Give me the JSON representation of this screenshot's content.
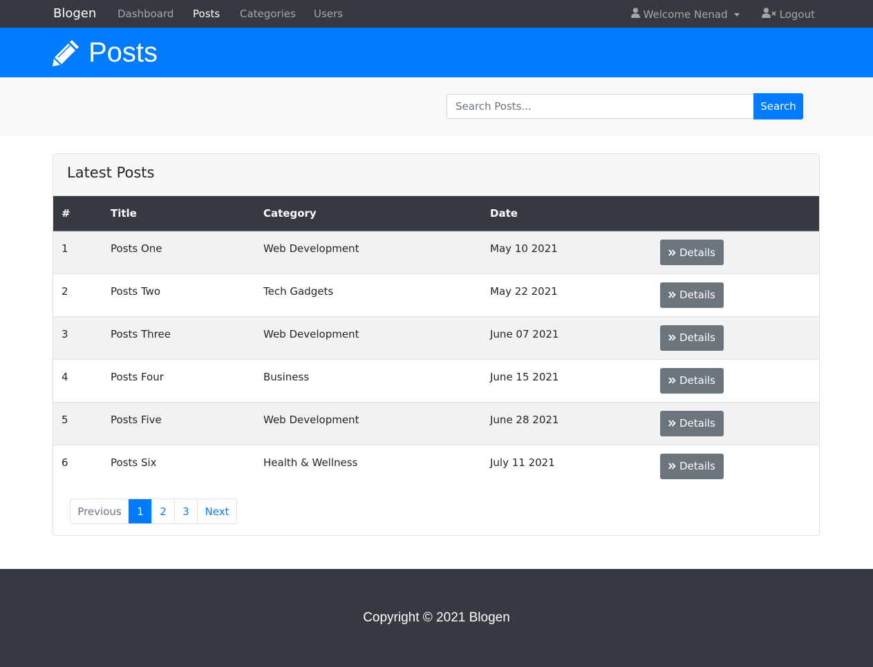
{
  "navbar": {
    "brand": "Blogen",
    "links": [
      {
        "label": "Dashboard",
        "active": false
      },
      {
        "label": "Posts",
        "active": true
      },
      {
        "label": "Categories",
        "active": false
      },
      {
        "label": "Users",
        "active": false
      }
    ],
    "user_menu": "Welcome Nenad",
    "logout": "Logout"
  },
  "header": {
    "title": "Posts",
    "icon": "pencil-icon"
  },
  "search": {
    "placeholder": "Search Posts...",
    "button_label": "Search"
  },
  "card": {
    "title": "Latest Posts"
  },
  "table": {
    "columns": [
      "#",
      "Title",
      "Category",
      "Date",
      ""
    ],
    "rows": [
      {
        "num": "1",
        "title": "Posts One",
        "category": "Web Development",
        "date": "May 10 2021"
      },
      {
        "num": "2",
        "title": "Posts Two",
        "category": "Tech Gadgets",
        "date": "May 22 2021"
      },
      {
        "num": "3",
        "title": "Posts Three",
        "category": "Web Development",
        "date": "June 07 2021"
      },
      {
        "num": "4",
        "title": "Posts Four",
        "category": "Business",
        "date": "June 15 2021"
      },
      {
        "num": "5",
        "title": "Posts Five",
        "category": "Web Development",
        "date": "June 28 2021"
      },
      {
        "num": "6",
        "title": "Posts Six",
        "category": "Health & Wellness",
        "date": "July 11 2021"
      }
    ],
    "details_label": "Details"
  },
  "pagination": {
    "previous": "Previous",
    "pages": [
      "1",
      "2",
      "3"
    ],
    "active_page": "1",
    "next": "Next"
  },
  "footer": {
    "copyright": "Copyright © 2021 Blogen"
  },
  "colors": {
    "primary": "#007bff",
    "dark": "#343a40",
    "secondary": "#6c757d"
  }
}
